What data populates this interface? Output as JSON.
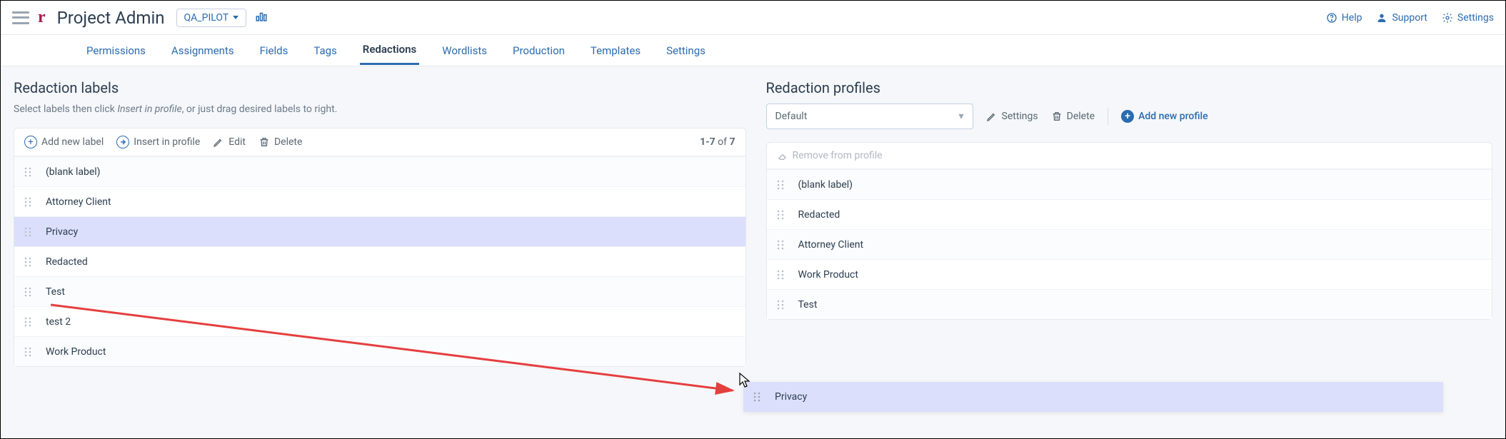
{
  "header": {
    "page_title": "Project Admin",
    "project": "QA_PILOT",
    "links": {
      "help": "Help",
      "support": "Support",
      "settings": "Settings"
    }
  },
  "tabs": [
    "Permissions",
    "Assignments",
    "Fields",
    "Tags",
    "Redactions",
    "Wordlists",
    "Production",
    "Templates",
    "Settings"
  ],
  "active_tab": "Redactions",
  "labels_panel": {
    "title": "Redaction labels",
    "subtitle_pre": "Select labels then click ",
    "subtitle_em": "Insert in profile",
    "subtitle_post": ", or just drag desired labels to right.",
    "toolbar": {
      "add": "Add new label",
      "insert": "Insert in profile",
      "edit": "Edit",
      "delete": "Delete",
      "count_range": "1-7",
      "count_of": " of ",
      "count_total": "7"
    },
    "rows": [
      "(blank label)",
      "Attorney Client",
      "Privacy",
      "Redacted",
      "Test",
      "test 2",
      "Work Product"
    ],
    "selected_index": 2
  },
  "profiles_panel": {
    "title": "Redaction profiles",
    "select_value": "Default",
    "settings": "Settings",
    "delete": "Delete",
    "add": "Add new profile",
    "toolbar": {
      "remove": "Remove from profile"
    },
    "rows": [
      "(blank label)",
      "Redacted",
      "Attorney Client",
      "Work Product",
      "Test"
    ],
    "dragging_label": "Privacy"
  }
}
